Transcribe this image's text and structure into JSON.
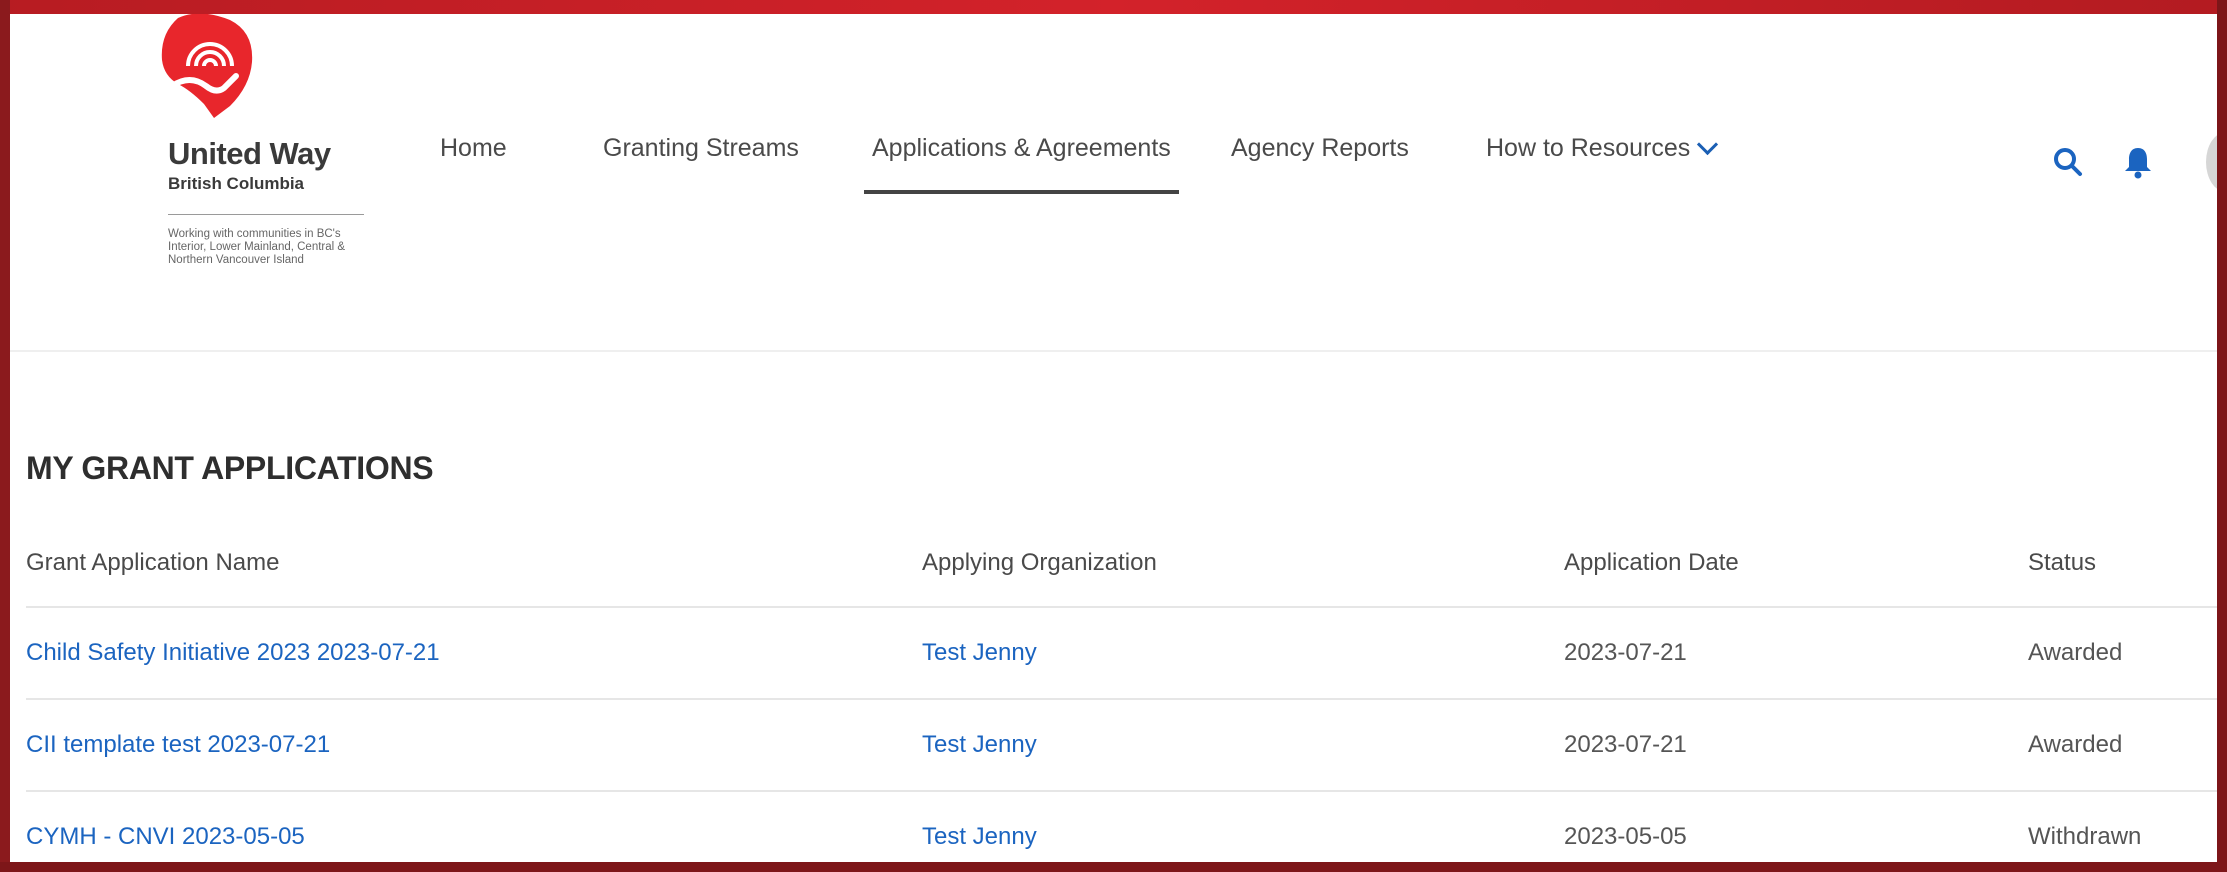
{
  "brand": {
    "name": "United Way",
    "region": "British Columbia",
    "tagline": "Working with communities in BC's Interior, Lower Mainland, Central & Northern Vancouver Island",
    "colors": {
      "logo_red": "#e8262c",
      "frame": "#8e1b1e",
      "link": "#1b64c0"
    }
  },
  "nav": {
    "items": [
      {
        "label": "Home"
      },
      {
        "label": "Granting Streams"
      },
      {
        "label": "Applications & Agreements",
        "active": true
      },
      {
        "label": "Agency Reports"
      },
      {
        "label": "How to Resources"
      }
    ]
  },
  "header_icons": [
    "search-icon",
    "bell-icon",
    "avatar"
  ],
  "section": {
    "title": "MY GRANT APPLICATIONS"
  },
  "table": {
    "columns": [
      "Grant Application Name",
      "Applying Organization",
      "Application Date",
      "Status"
    ],
    "rows": [
      {
        "name": "Child Safety Initiative 2023 2023-07-21",
        "organization": "Test Jenny",
        "date": "2023-07-21",
        "status": "Awarded"
      },
      {
        "name": "CII template test 2023-07-21",
        "organization": "Test Jenny",
        "date": "2023-07-21",
        "status": "Awarded"
      },
      {
        "name": "CYMH - CNVI 2023-05-05",
        "organization": "Test Jenny",
        "date": "2023-05-05",
        "status": "Withdrawn"
      }
    ]
  }
}
